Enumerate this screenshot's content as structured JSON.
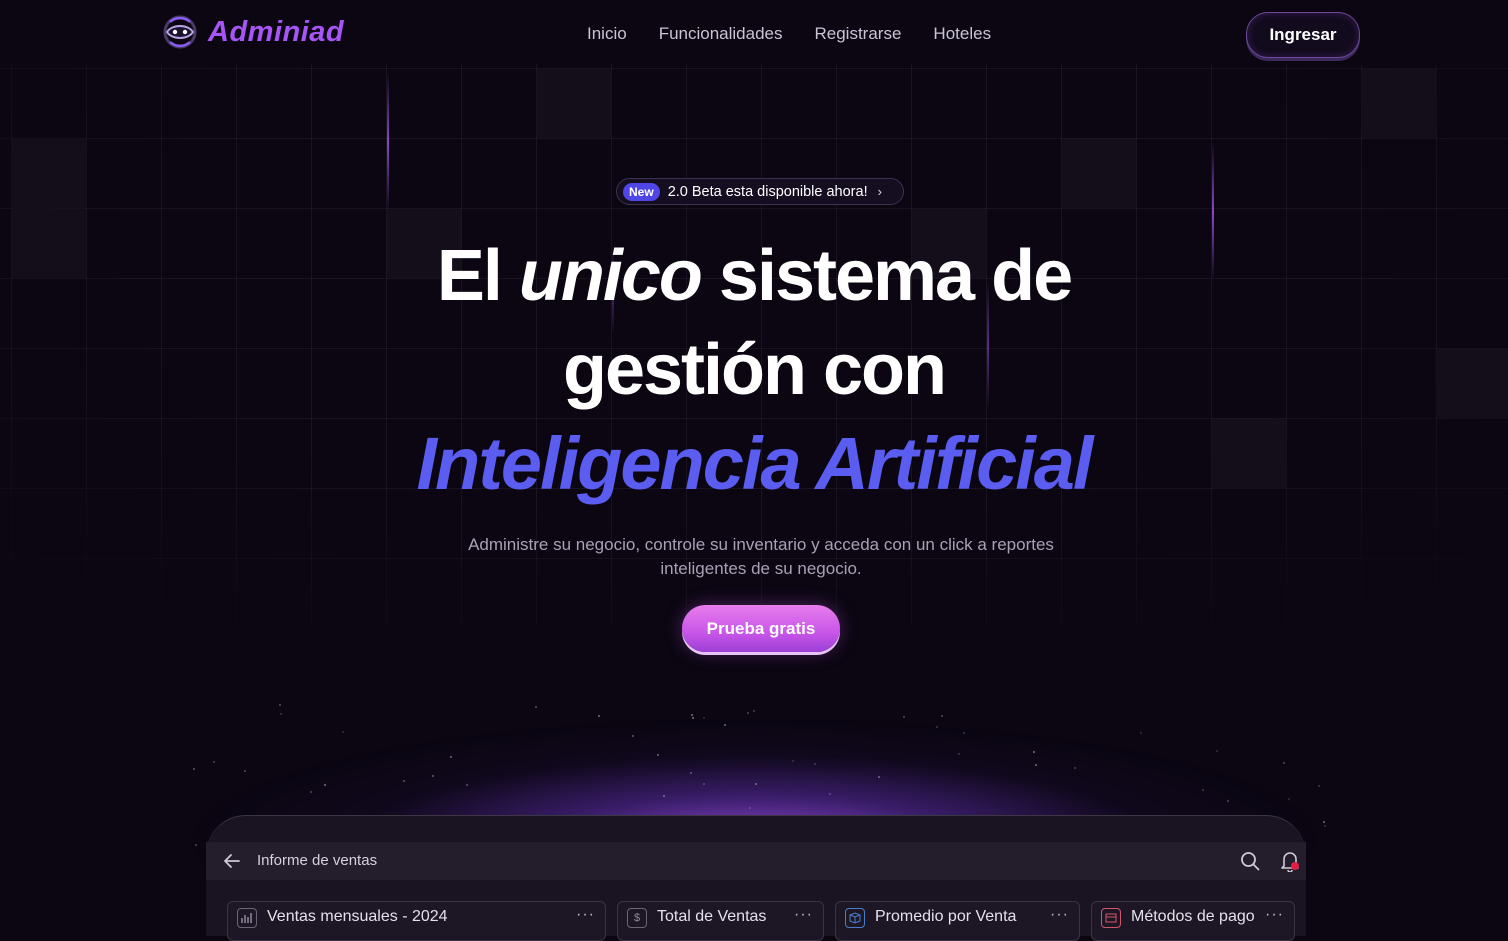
{
  "brand": {
    "name": "Adminiad",
    "accent": "#a855f7"
  },
  "nav": {
    "links": [
      "Inicio",
      "Funcionalidades",
      "Registrarse",
      "Hoteles"
    ],
    "login_label": "Ingresar"
  },
  "badge": {
    "tag": "New",
    "text": "2.0 Beta esta disponible ahora!",
    "chevron": "›"
  },
  "hero": {
    "line1_pre": "El ",
    "line1_em": "unico",
    "line1_post": " sistema de",
    "line2": "gestión con",
    "line3": "Inteligencia Artificial",
    "line3_color": "#5b5cf0"
  },
  "subtitle": "Administre su negocio, controle su inventario y acceda con un click a reportes inteligentes de su negocio.",
  "cta_label": "Prueba gratis",
  "dashboard": {
    "title": "Informe de ventas",
    "cards": [
      {
        "title": "Ventas mensuales - 2024",
        "icon": "bar-chart-icon"
      },
      {
        "title": "Total de Ventas",
        "icon": "dollar-icon"
      },
      {
        "title": "Promedio por Venta",
        "icon": "box-icon"
      },
      {
        "title": "Métodos de pago",
        "icon": "card-icon"
      }
    ],
    "menu_glyph": "···"
  }
}
